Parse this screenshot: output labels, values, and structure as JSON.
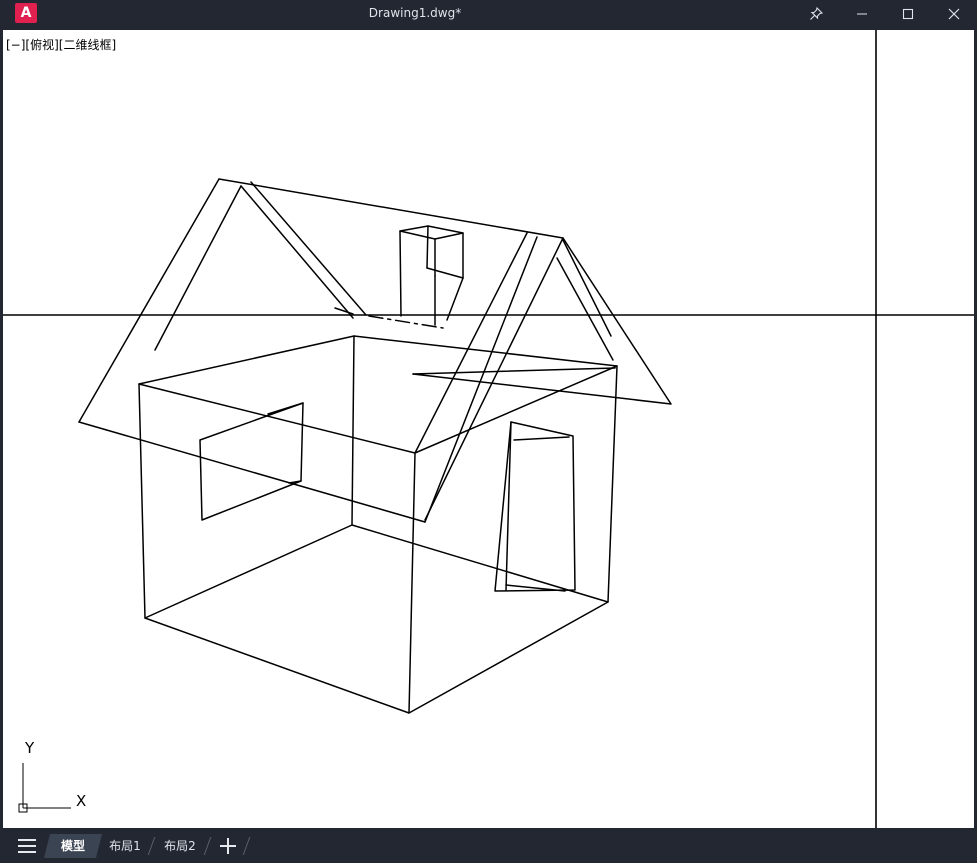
{
  "window": {
    "app_logo": "A",
    "title": "Drawing1.dwg*",
    "controls": [
      "pin-icon",
      "minimize-icon",
      "maximize-icon",
      "close-icon"
    ]
  },
  "viewport": {
    "label": "[−][俯视][二维线框]",
    "ucs": {
      "x_label": "X",
      "y_label": "Y"
    }
  },
  "tabs": {
    "menu_icon": "hamburger-icon",
    "items": [
      {
        "label": "模型",
        "active": true
      },
      {
        "label": "布局1",
        "active": false
      },
      {
        "label": "布局2",
        "active": false
      }
    ],
    "add_icon": "plus-icon"
  },
  "colors": {
    "chrome": "#222732",
    "canvas": "#ffffff",
    "active_tab": "#3b4453",
    "logo": "#e0204f"
  }
}
